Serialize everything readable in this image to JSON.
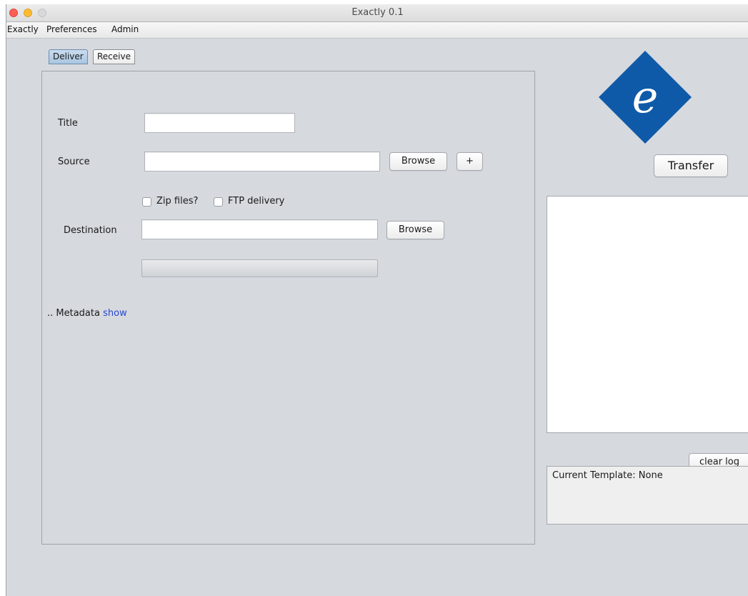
{
  "window": {
    "title": "Exactly 0.1"
  },
  "menu": [
    "Exactly",
    "Preferences",
    "Admin"
  ],
  "tabs": {
    "deliver": "Deliver",
    "receive": "Receive"
  },
  "form": {
    "title_label": "Title",
    "source_label": "Source",
    "browse_label": "Browse",
    "plus_label": "+",
    "zip_label": "Zip files?",
    "ftp_label": "FTP delivery",
    "destination_label": "Destination",
    "metadata_prefix": ".. Metadata",
    "metadata_link": "show",
    "title_value": "",
    "source_value": "",
    "destination_value": "",
    "zip_checked": false,
    "ftp_checked": false
  },
  "right": {
    "logo_letter": "e",
    "logo_color": "#0f5aa8",
    "transfer_label": "Transfer",
    "log_text": "",
    "clear_log_label": "clear log",
    "template_text": "Current Template: None"
  }
}
